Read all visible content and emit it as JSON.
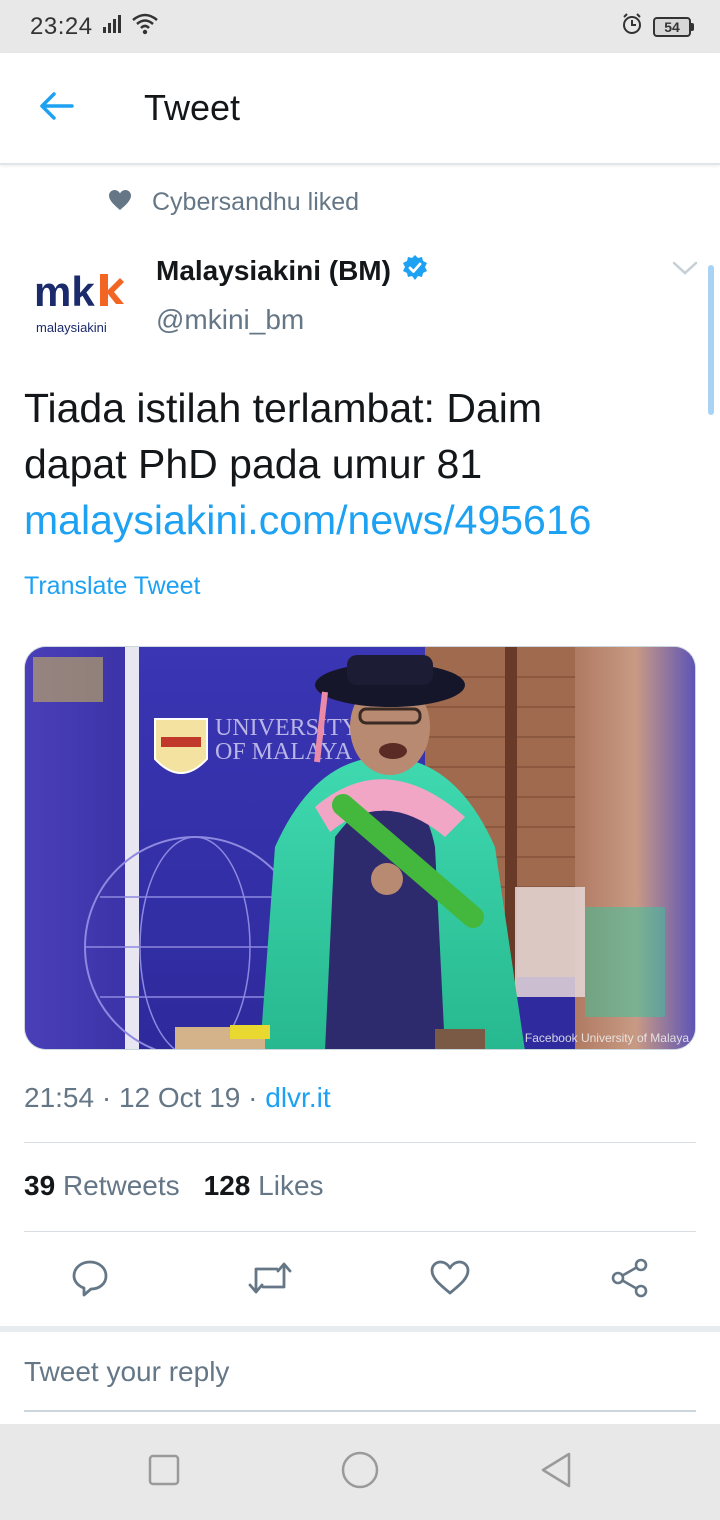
{
  "status_bar": {
    "time": "23:24",
    "battery": "54",
    "icons": [
      "signal-icon",
      "wifi-icon",
      "alarm-icon",
      "battery-icon"
    ]
  },
  "header": {
    "title": "Tweet",
    "back_icon": "arrow-left-icon"
  },
  "social_context": {
    "icon": "heart-icon",
    "text": "Cybersandhu liked"
  },
  "author": {
    "avatar_text_main": "mk",
    "avatar_text_sub": "malaysiakini",
    "name": "Malaysiakini (BM)",
    "verified": true,
    "handle": "@mkini_bm"
  },
  "tweet": {
    "line1": "Tiada istilah terlambat: Daim",
    "line2": "dapat PhD pada umur 81",
    "link": "malaysiakini.com/news/495616",
    "translate_label": "Translate Tweet",
    "media": {
      "banner_text_1": "UNIVERSITY",
      "banner_text_2": "OF MALAYA",
      "credit": "Facebook University of Malaya"
    }
  },
  "meta": {
    "time": "21:54",
    "separator": " · ",
    "date": "12 Oct 19",
    "source": "dlvr.it"
  },
  "stats": {
    "retweets_count": "39",
    "retweets_label": "Retweets",
    "likes_count": "128",
    "likes_label": "Likes"
  },
  "actions": [
    "reply-icon",
    "retweet-icon",
    "like-icon",
    "share-icon"
  ],
  "reply": {
    "placeholder": "Tweet your reply"
  },
  "nav": [
    "recent-apps-button",
    "home-button",
    "back-button"
  ],
  "colors": {
    "accent": "#1da1f2",
    "secondary_text": "#657786",
    "primary_text": "#14171a",
    "brand_orange": "#f26522",
    "brand_navy": "#1b2a6b"
  }
}
